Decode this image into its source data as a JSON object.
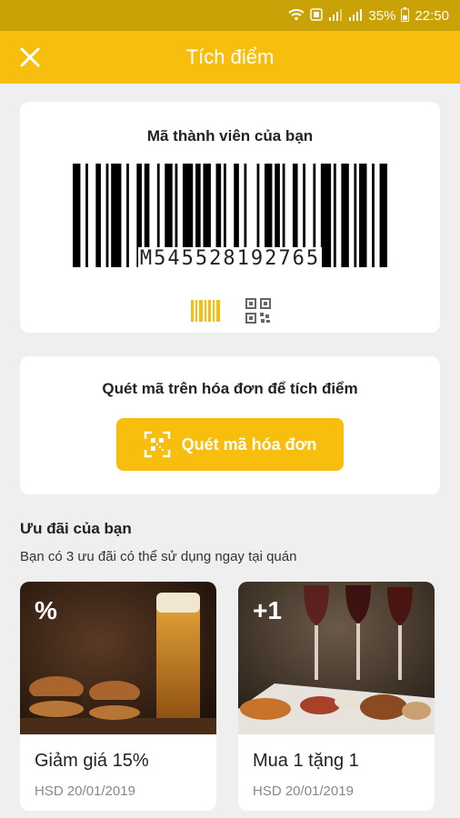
{
  "status": {
    "battery": "35%",
    "time": "22:50"
  },
  "header": {
    "title": "Tích điểm"
  },
  "member": {
    "title": "Mã thành viên của bạn",
    "code": "M545528192765"
  },
  "scan": {
    "title": "Quét mã trên hóa đơn để tích điểm",
    "button_label": "Quét mã hóa đơn"
  },
  "offers": {
    "title": "Ưu đãi của bạn",
    "subtitle": "Bạn có 3 ưu đãi có thể sử dụng ngay tại quán",
    "items": [
      {
        "badge": "%",
        "name": "Giảm giá 15%",
        "expiry": "HSD 20/01/2019"
      },
      {
        "badge": "+1",
        "name": "Mua 1 tặng 1",
        "expiry": "HSD 20/01/2019"
      }
    ]
  },
  "colors": {
    "accent": "#f7be0d",
    "statusbar": "#c9a208",
    "background": "#efefef"
  }
}
